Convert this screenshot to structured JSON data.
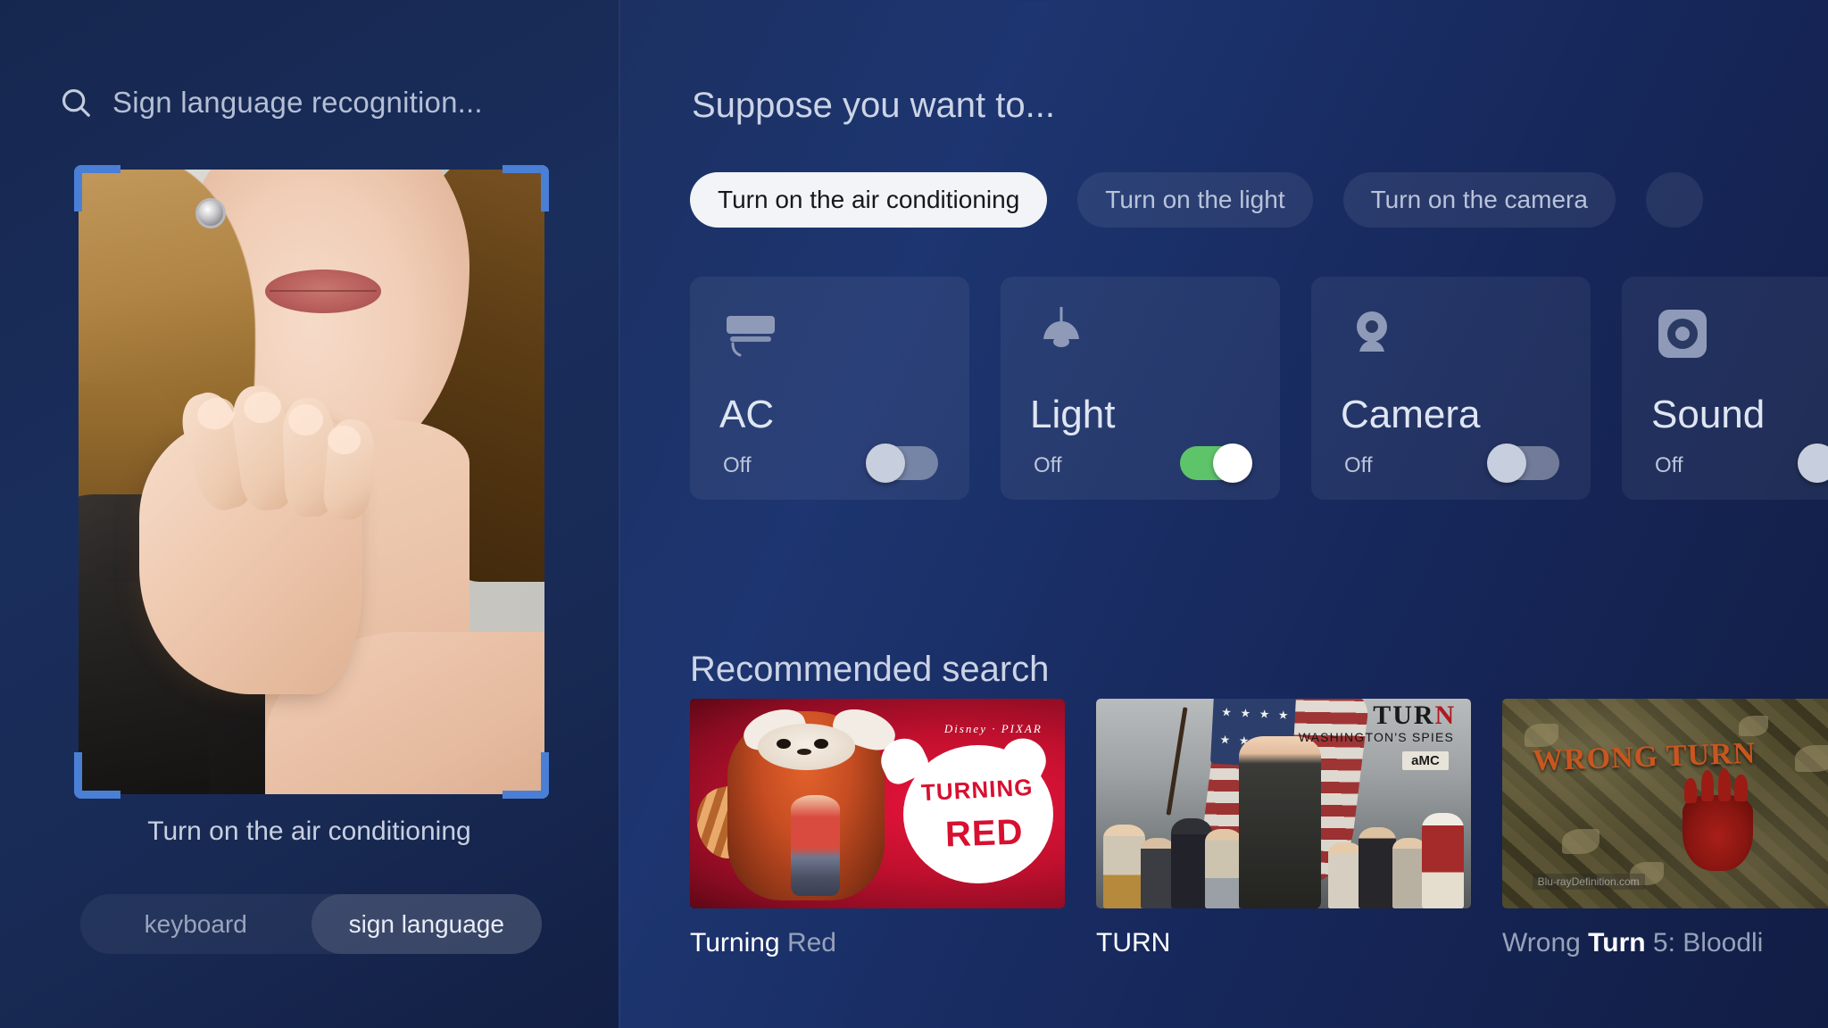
{
  "search": {
    "placeholder": "Sign language recognition...",
    "icon": "search-icon"
  },
  "camera": {
    "recognized_caption": "Turn on the air conditioning",
    "frame_color": "#4a7fd6"
  },
  "input_mode": {
    "options": [
      "keyboard",
      "sign language"
    ],
    "selected": "sign language"
  },
  "suggestions": {
    "title": "Suppose you want to...",
    "chips": [
      {
        "label": "Turn on the air conditioning",
        "active": true
      },
      {
        "label": "Turn on the light",
        "active": false
      },
      {
        "label": "Turn on the camera",
        "active": false
      },
      {
        "label": "",
        "active": false
      }
    ]
  },
  "devices": {
    "state_label": "Off",
    "items": [
      {
        "name": "AC",
        "state": "Off",
        "toggle": "off",
        "icon": "air-conditioner-icon"
      },
      {
        "name": "Light",
        "state": "Off",
        "toggle": "on",
        "icon": "pendant-lamp-icon"
      },
      {
        "name": "Camera",
        "state": "Off",
        "toggle": "off",
        "icon": "webcam-icon"
      },
      {
        "name": "Sound",
        "state": "Off",
        "toggle": "off",
        "icon": "speaker-icon"
      }
    ],
    "toggle_on_color": "#5ec46a",
    "toggle_off_color": "#c7cedd"
  },
  "recommended": {
    "title": "Recommended search",
    "items": [
      {
        "title_match": "Turning",
        "title_rest": " Red",
        "poster": "turning-red-poster",
        "poster_text": {
          "studio": "Disney · PIXAR",
          "line1": "TURNING",
          "line2": "RED"
        }
      },
      {
        "title_match": "TURN",
        "title_rest": "",
        "poster": "turn-poster",
        "poster_text": {
          "title": "TURN",
          "subtitle": "WASHINGTON'S SPIES",
          "network": "aMC"
        }
      },
      {
        "title_match": "Turn",
        "title_prefix": "Wrong ",
        "title_rest": " 5: Bloodli",
        "poster": "wrong-turn-poster",
        "poster_text": {
          "title": "WRONG TURN",
          "watermark": "Blu-rayDefinition.com"
        }
      }
    ]
  }
}
